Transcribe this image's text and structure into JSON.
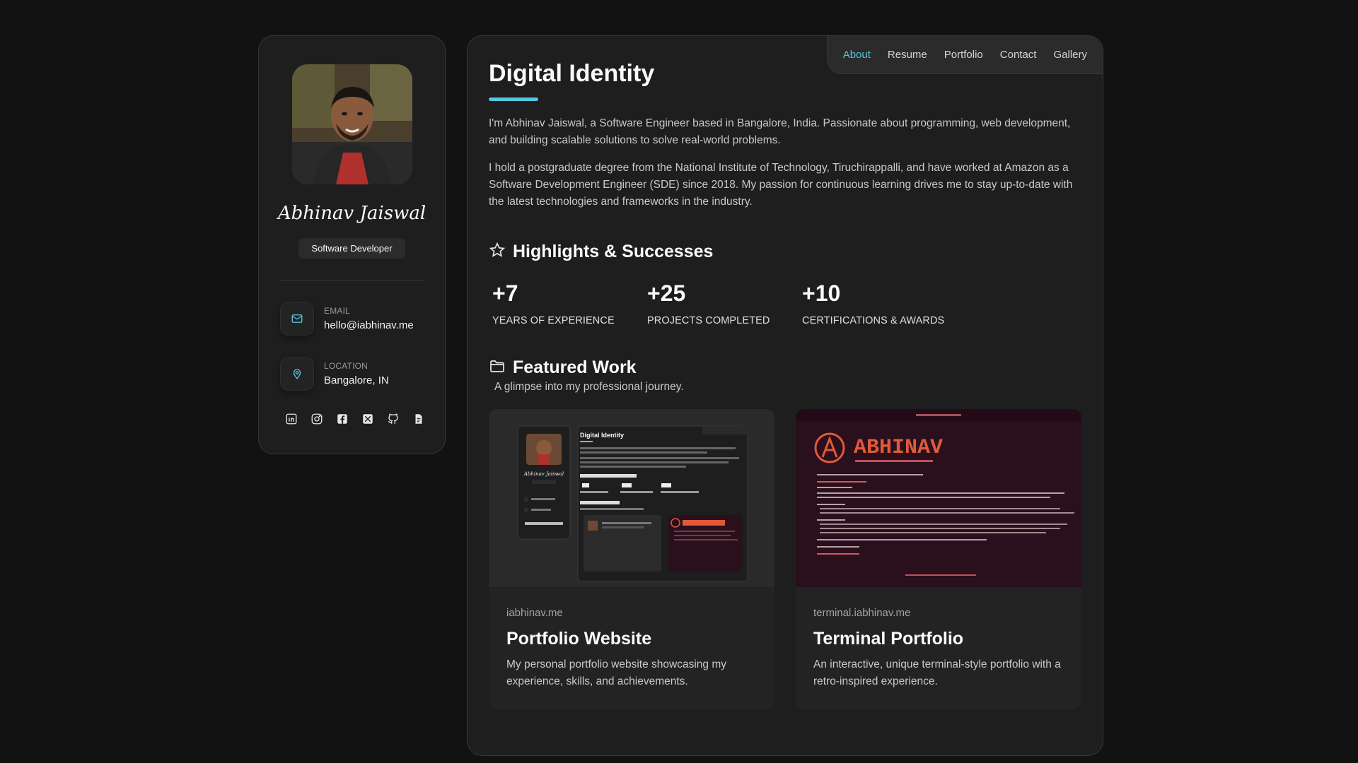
{
  "profile": {
    "name": "Abhinav Jaiswal",
    "role": "Software Developer",
    "contacts": [
      {
        "label": "EMAIL",
        "value": "hello@iabhinav.me",
        "icon": "mail-icon"
      },
      {
        "label": "LOCATION",
        "value": "Bangalore, IN",
        "icon": "location-pin-icon"
      }
    ],
    "socials": [
      "linkedin-icon",
      "instagram-icon",
      "facebook-icon",
      "x-twitter-icon",
      "github-icon",
      "resume-document-icon"
    ]
  },
  "nav": {
    "items": [
      "About",
      "Resume",
      "Portfolio",
      "Contact",
      "Gallery"
    ],
    "active": "About"
  },
  "about": {
    "title": "Digital Identity",
    "paragraphs": [
      "I'm Abhinav Jaiswal, a Software Engineer based in Bangalore, India. Passionate about programming, web development, and building scalable solutions to solve real-world problems.",
      "I hold a postgraduate degree from the National Institute of Technology, Tiruchirappalli, and have worked at Amazon as a Software Development Engineer (SDE) since 2018. My passion for continuous learning drives me to stay up-to-date with the latest technologies and frameworks in the industry."
    ]
  },
  "highlights": {
    "title": "Highlights & Successes",
    "icon": "star-icon",
    "stats": [
      {
        "value": "+7",
        "label": "YEARS OF EXPERIENCE"
      },
      {
        "value": "+25",
        "label": "PROJECTS COMPLETED"
      },
      {
        "value": "+10",
        "label": "CERTIFICATIONS & AWARDS"
      }
    ]
  },
  "featured": {
    "title": "Featured Work",
    "icon": "folder-icon",
    "subtitle": "A glimpse into my professional journey.",
    "projects": [
      {
        "url": "iabhinav.me",
        "title": "Portfolio Website",
        "description": "My personal portfolio website showcasing my experience, skills, and achievements.",
        "thumb_text": {
          "name": "Abhinav Jaiswal",
          "heading": "Digital Identity"
        }
      },
      {
        "url": "terminal.iabhinav.me",
        "title": "Terminal Portfolio",
        "description": "An interactive, unique terminal-style portfolio with a retro-inspired experience.",
        "thumb_text": {
          "banner": "ABHINAV"
        }
      }
    ]
  },
  "colors": {
    "accent": "#55c6dd",
    "background": "#121212",
    "panel": "#1e1e1f",
    "terminal_bg": "#2a0f1c",
    "terminal_accent": "#e05a3a"
  }
}
